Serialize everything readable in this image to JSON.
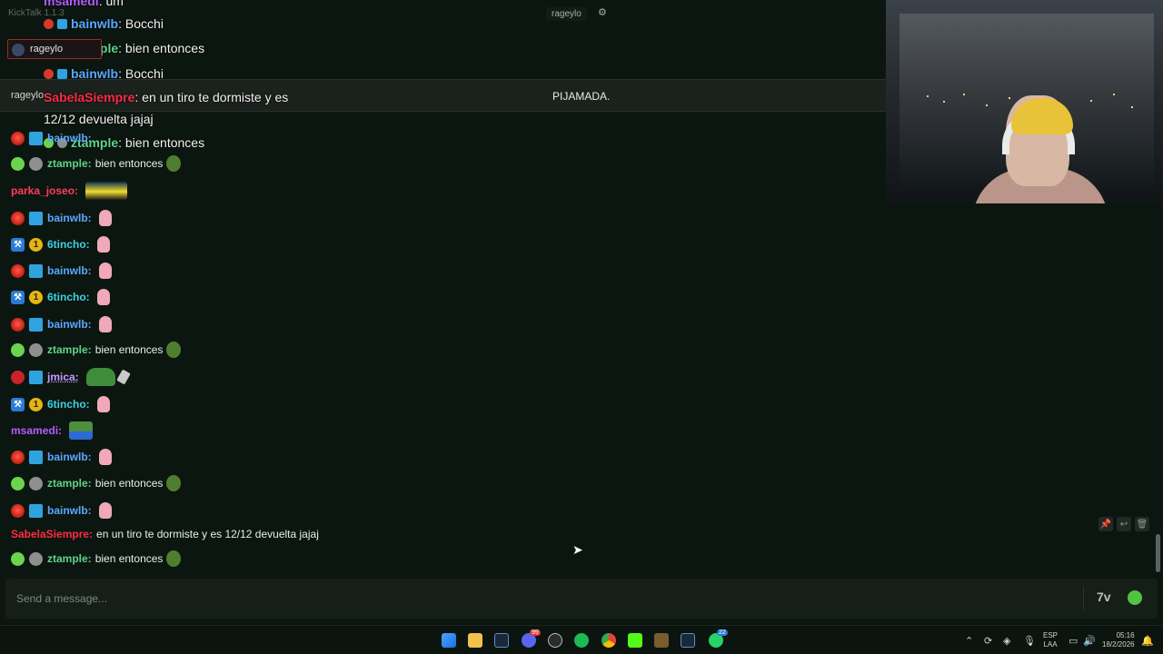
{
  "app": {
    "title": "KickTalk 1.1.3"
  },
  "header": {
    "tab_user": "rageylo",
    "chip_user": "rageylo"
  },
  "pinned": {
    "user": "rageylo",
    "title": "PIJAMADA."
  },
  "overlay": {
    "line0": {
      "user": "msamedi",
      "text": "um"
    },
    "line1": {
      "user": "bainwlb",
      "text": "Bocchi"
    },
    "line2": {
      "user": "ztample",
      "text": "bien entonces"
    },
    "line3": {
      "user": "bainwlb",
      "text": "Bocchi"
    },
    "line4": {
      "user": "SabelaSiempre",
      "text": "en un tiro te dormiste y es"
    },
    "line4b": "12/12 devuelta jajaj",
    "line5": {
      "user": "ztample",
      "text": "bien entonces"
    }
  },
  "messages": [
    {
      "user": "bainwlb",
      "text": ""
    },
    {
      "user": "ztample",
      "text": "bien entonces"
    },
    {
      "user": "parka_joseo",
      "text": ""
    },
    {
      "user": "bainwlb",
      "text": ""
    },
    {
      "user": "6tincho",
      "text": ""
    },
    {
      "user": "bainwlb",
      "text": ""
    },
    {
      "user": "6tincho",
      "text": ""
    },
    {
      "user": "bainwlb",
      "text": ""
    },
    {
      "user": "ztample",
      "text": "bien entonces"
    },
    {
      "user": "jmica",
      "text": ""
    },
    {
      "user": "6tincho",
      "text": ""
    },
    {
      "user": "msamedi",
      "text": ""
    },
    {
      "user": "bainwlb",
      "text": ""
    },
    {
      "user": "ztample",
      "text": "bien entonces"
    },
    {
      "user": "bainwlb",
      "text": ""
    },
    {
      "user": "SabelaSiempre",
      "text": "en un tiro te dormiste y es 12/12 devuelta jajaj"
    },
    {
      "user": "ztample",
      "text": "bien entonces"
    }
  ],
  "input": {
    "placeholder": "Send a message..."
  },
  "taskbar": {
    "discord_badge": "99",
    "whatsapp_badge": "22",
    "lang_top": "ESP",
    "lang_bottom": "LAA",
    "time": "05:16",
    "date": "18/2/2026"
  },
  "colors": {
    "accent": "#53c244",
    "chat_bg": "#0c1610",
    "pinned_bg": "#1b211d"
  }
}
